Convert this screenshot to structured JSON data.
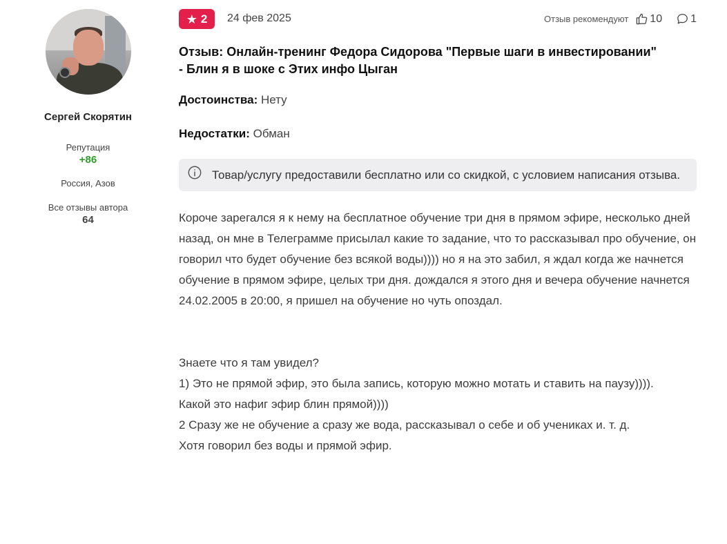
{
  "author": {
    "name": "Сергей Скорятин",
    "reputation_label": "Репутация",
    "reputation_value": "+86",
    "location": "Россия, Азов",
    "all_reviews_label": "Все отзывы автора",
    "all_reviews_count": "64"
  },
  "review": {
    "rating": "2",
    "date": "24 фев 2025",
    "recommend_label": "Отзыв рекомендуют",
    "likes": "10",
    "comments": "1",
    "title": "Отзыв: Онлайн-тренинг Федора Сидорова \"Первые шаги в инвестировании\" - Блин я в шоке с Этих инфо Цыган",
    "pros_label": "Достоинства:",
    "pros_value": "Нету",
    "cons_label": "Недостатки:",
    "cons_value": "Обман",
    "notice": "Товар/услугу предоставили бесплатно или со скидкой, с условием написания отзыва.",
    "text": "Короче зарегался я к нему на бесплатное обучение три дня в прямом эфире, несколько дней назад, он мне в Телеграмме присылал какие то задание, что то рассказывал про обучение, он говорил что будет обучение без всякой воды)))) но я на это забил, я ждал когда же начнется обучение в прямом эфире, целых три дня. дождался я этого дня и вечера обучение начнется 24.02.2005 в 20:00, я пришел на обучение но чуть опоздал.\n\n\nЗнаете что я там увидел?\n1) Это не прямой эфир, это была запись, которую можно мотать и ставить на паузу)))).\nКакой это нафиг эфир блин прямой))))\n2 Сразу же не обучение а сразу же вода, рассказывал о себе и об учениках и. т. д.\nХотя говорил без воды и прямой эфир."
  },
  "colors": {
    "rating_badge": "#e3204b",
    "reputation": "#2e9e28",
    "notice_bg": "#eeeef0"
  },
  "icons": [
    "star-icon",
    "thumbs-up-icon",
    "comment-icon",
    "info-icon"
  ]
}
